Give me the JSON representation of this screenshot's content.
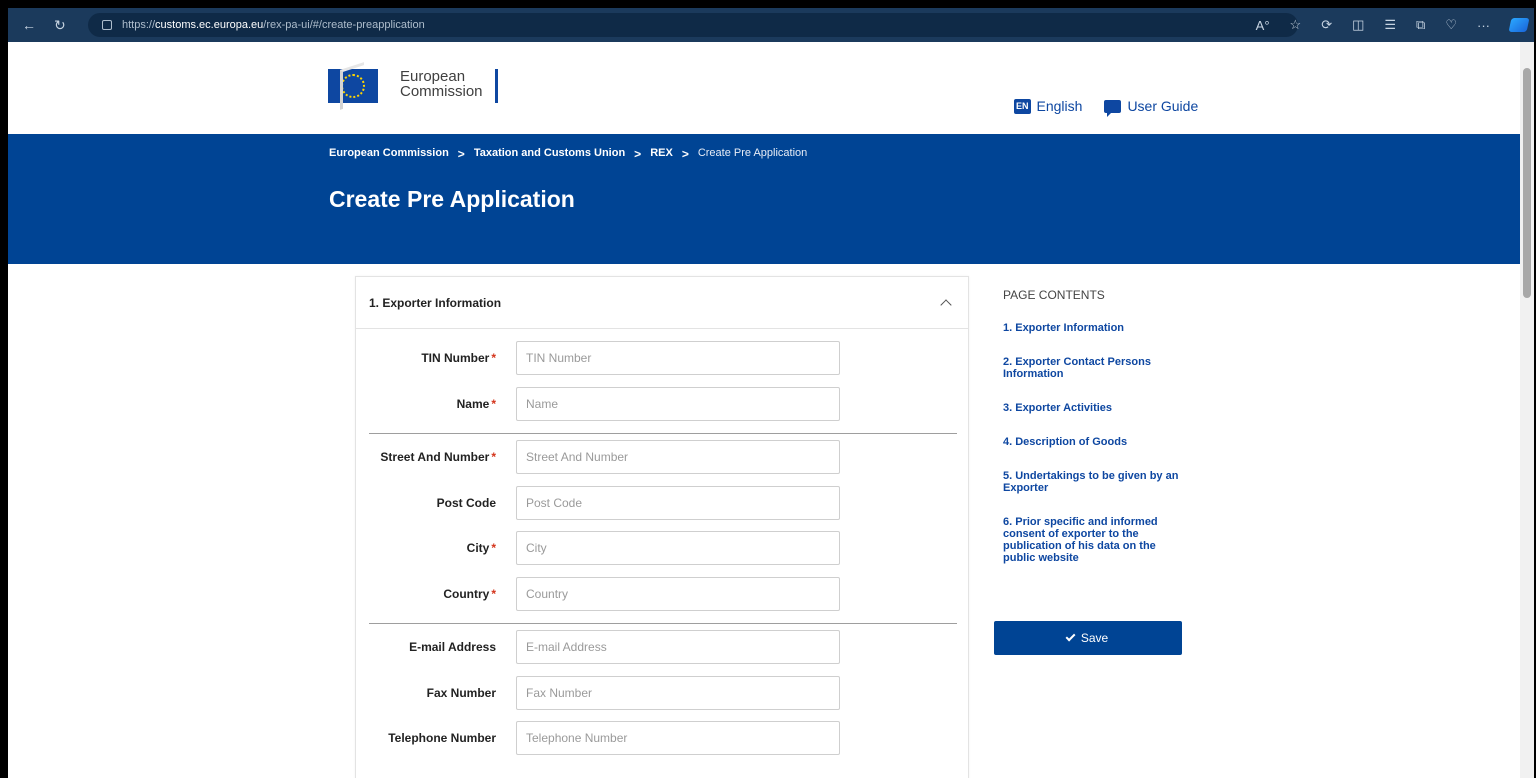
{
  "browser": {
    "url_prefix": "https://",
    "url_domain": "customs.ec.europa.eu",
    "url_path": "/rex-pa-ui/#/create-preapplication"
  },
  "header": {
    "logo_line1": "European",
    "logo_line2": "Commission",
    "language_badge": "EN",
    "language_label": "English",
    "guide_label": "User Guide"
  },
  "breadcrumb": [
    "European Commission",
    "Taxation and Customs Union",
    "REX",
    "Create Pre Application"
  ],
  "page_title": "Create Pre Application",
  "section": {
    "title": "1. Exporter Information",
    "fields": [
      {
        "label": "TIN Number",
        "placeholder": "TIN Number",
        "required": true
      },
      {
        "label": "Name",
        "placeholder": "Name",
        "required": true
      },
      {
        "label": "Street And Number",
        "placeholder": "Street And Number",
        "required": true
      },
      {
        "label": "Post Code",
        "placeholder": "Post Code",
        "required": false
      },
      {
        "label": "City",
        "placeholder": "City",
        "required": true
      },
      {
        "label": "Country",
        "placeholder": "Country",
        "required": true
      },
      {
        "label": "E-mail Address",
        "placeholder": "E-mail Address",
        "required": false
      },
      {
        "label": "Fax Number",
        "placeholder": "Fax Number",
        "required": false
      },
      {
        "label": "Telephone Number",
        "placeholder": "Telephone Number",
        "required": false
      }
    ]
  },
  "page_contents": {
    "heading": "PAGE CONTENTS",
    "items": [
      "1. Exporter Information",
      "2. Exporter Contact Persons Information",
      "3. Exporter Activities",
      "4. Description of Goods",
      "5. Undertakings to be given by an Exporter",
      "6. Prior specific and informed consent of exporter to the publication of his data on the public website"
    ]
  },
  "save_label": "Save",
  "colors": {
    "brand_blue": "#004494",
    "required_red": "#d4351c"
  }
}
